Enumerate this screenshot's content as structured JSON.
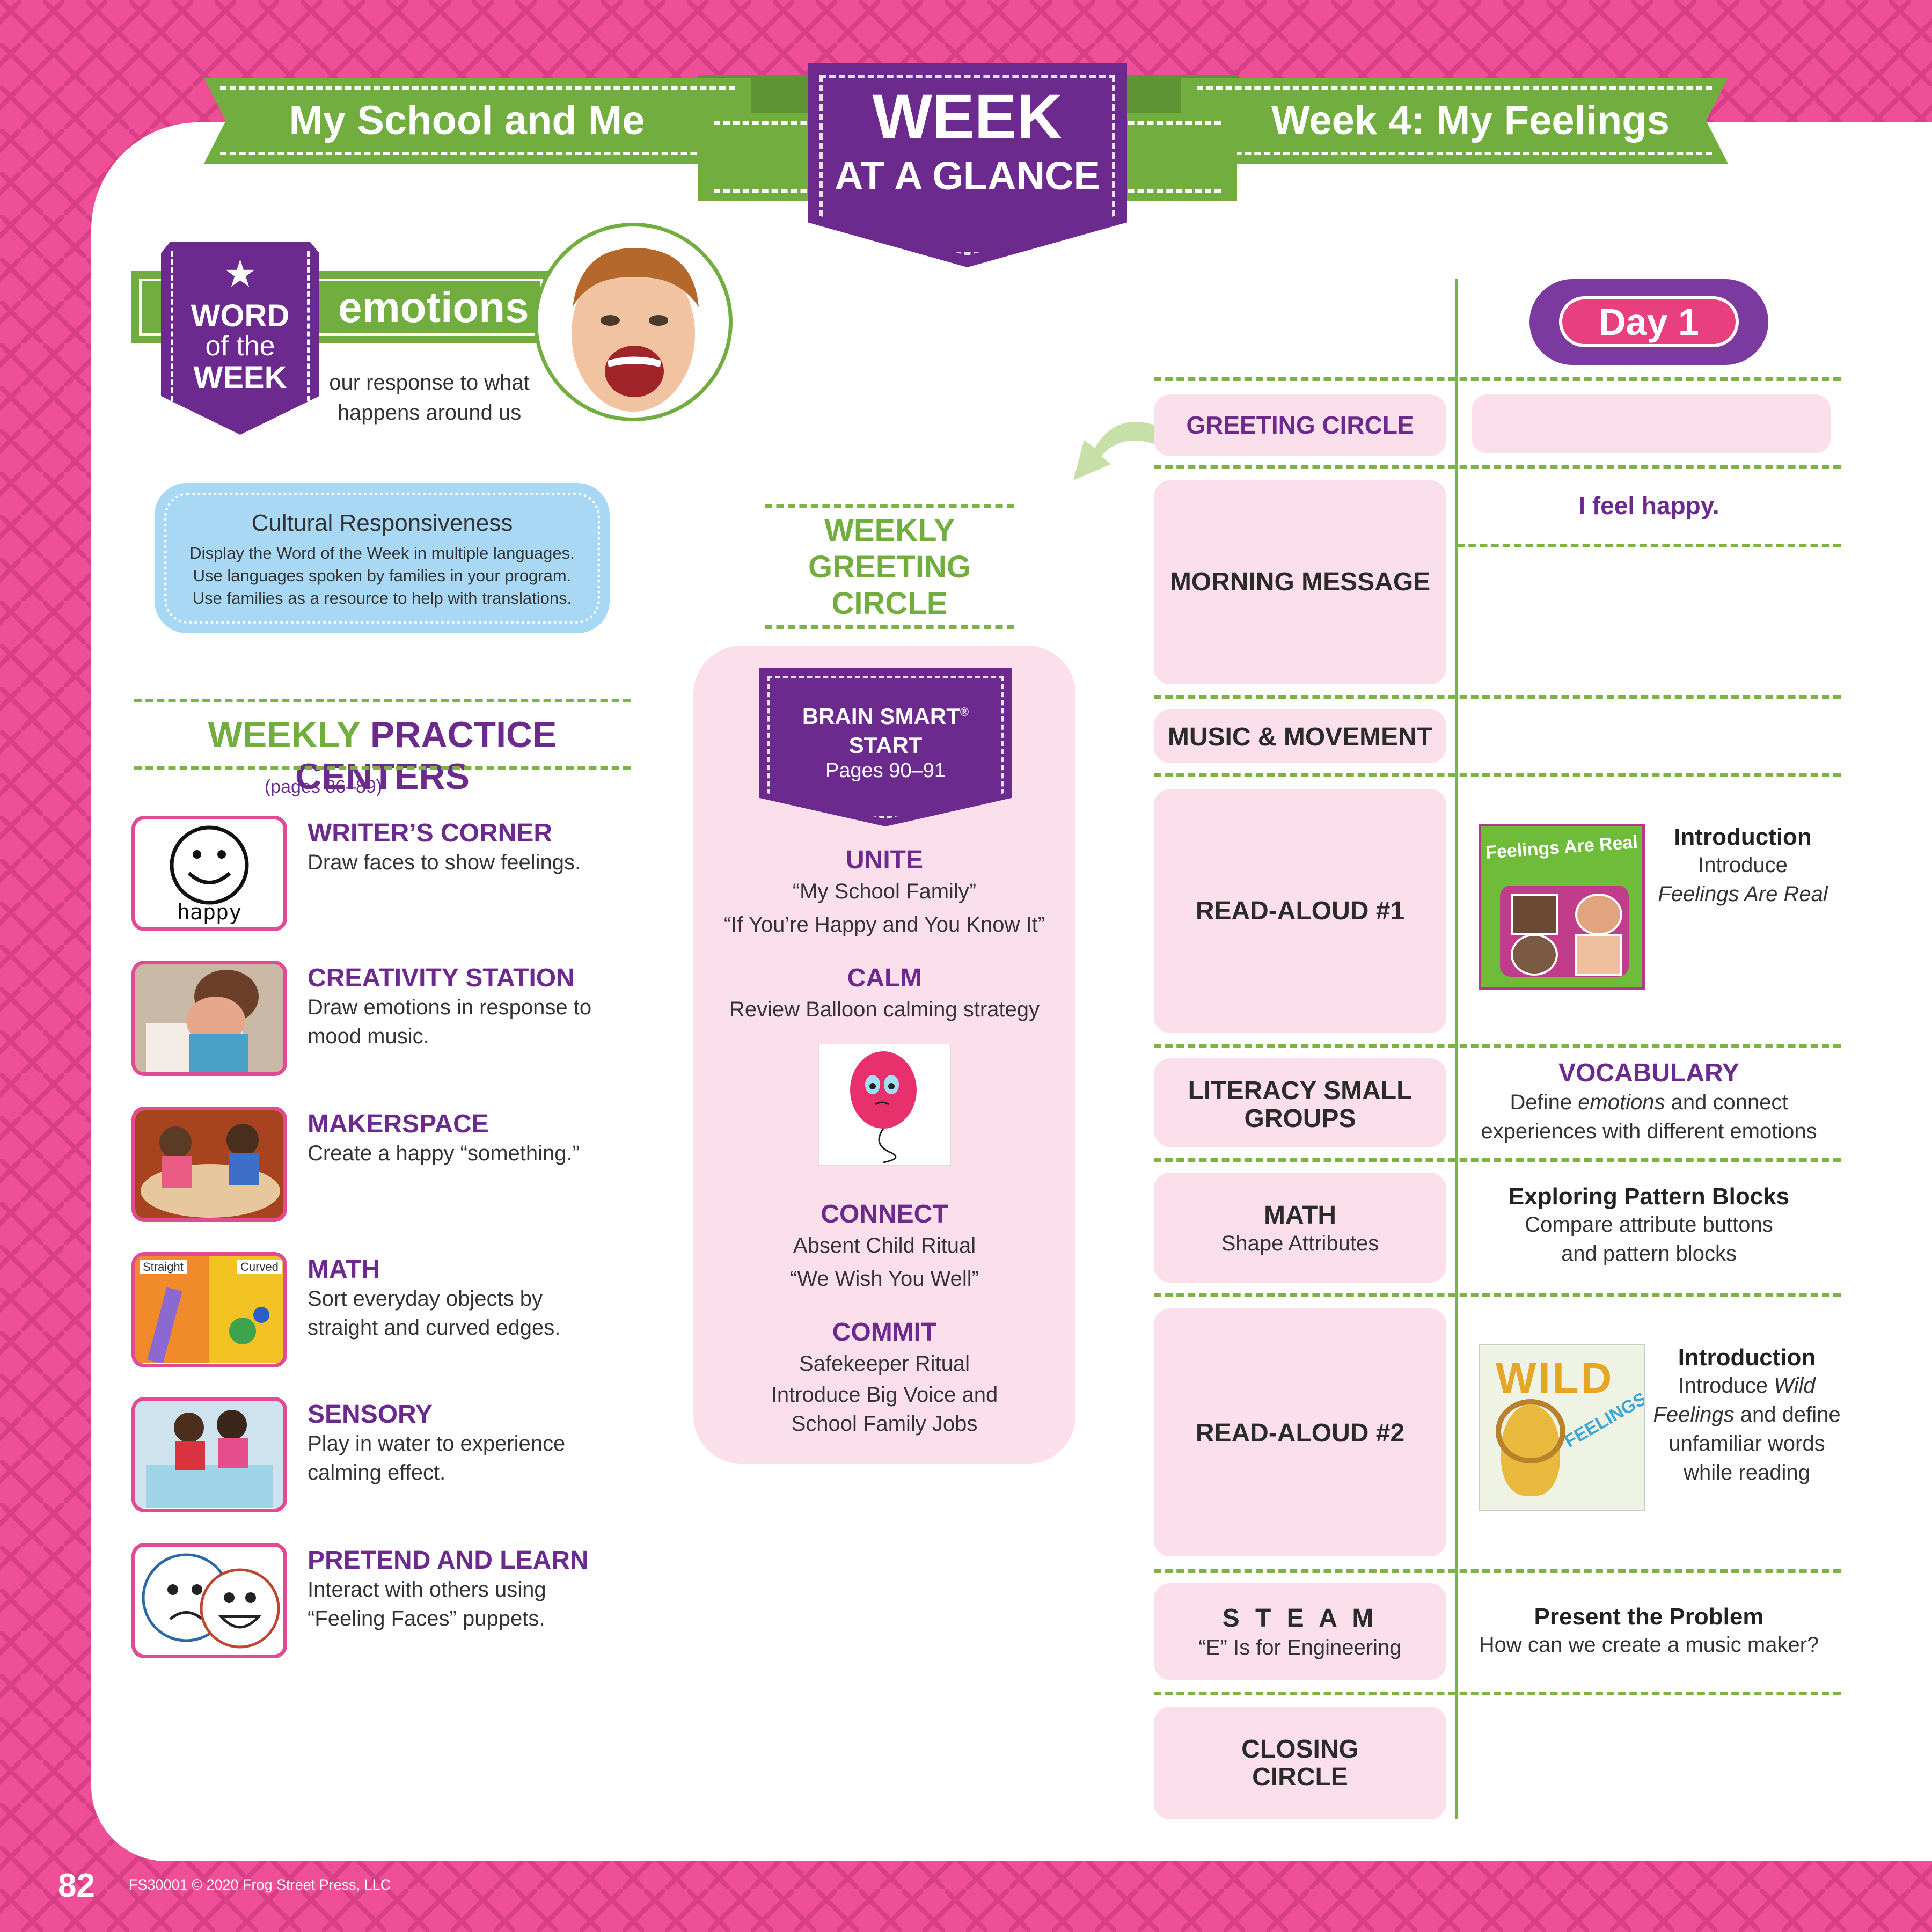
{
  "banner": {
    "left_title": "My School and Me",
    "right_title": "Week 4: My Feelings",
    "badge_line1": "WEEK",
    "badge_line2": "AT A GLANCE"
  },
  "word_of_week": {
    "badge_word": "WORD",
    "badge_of": "of the",
    "badge_week": "WEEK",
    "word": "emotions",
    "definition_line1": "our response to what",
    "definition_line2": "happens around us"
  },
  "cultural": {
    "title": "Cultural Responsiveness",
    "line1": "Display the Word of the Week in multiple languages.",
    "line2": "Use languages spoken by families in your program.",
    "line3": "Use families as a resource to help with translations."
  },
  "centers": {
    "heading_weekly": "WEEKLY",
    "heading_rest": "PRACTICE CENTERS",
    "pages": "(pages 86–89)",
    "happy_label": "happy",
    "thumb_straight": "Straight",
    "thumb_curved": "Curved",
    "items": [
      {
        "title": "WRITER’S CORNER",
        "line1": "Draw faces to show feelings.",
        "line2": ""
      },
      {
        "title": "CREATIVITY STATION",
        "line1": "Draw emotions in response to",
        "line2": "mood music."
      },
      {
        "title": "MAKERSPACE",
        "line1": "Create a happy “something.”",
        "line2": ""
      },
      {
        "title": "MATH",
        "line1": "Sort everyday objects by",
        "line2": "straight and curved edges."
      },
      {
        "title": "SENSORY",
        "line1": "Play in water to experience",
        "line2": "calming effect."
      },
      {
        "title": "PRETEND AND LEARN",
        "line1": "Interact with others using",
        "line2": "“Feeling Faces” puppets."
      }
    ]
  },
  "greeting": {
    "heading_line1": "WEEKLY",
    "heading_line2": "GREETING",
    "heading_line3": "CIRCLE",
    "brain_line1": "BRAIN SMART",
    "brain_reg": "®",
    "brain_line2": "START",
    "brain_pages": "Pages 90–91",
    "unite": "UNITE",
    "unite_1": "“My School Family”",
    "unite_2": "“If You’re Happy and You Know It”",
    "calm": "CALM",
    "calm_1": "Review Balloon calming strategy",
    "connect": "CONNECT",
    "connect_1": "Absent Child Ritual",
    "connect_2": "“We Wish You Well”",
    "commit": "COMMIT",
    "commit_1": "Safekeeper Ritual",
    "commit_2": "Introduce Big Voice and",
    "commit_3": "School Family Jobs"
  },
  "schedule": {
    "day": "Day 1",
    "rows": {
      "greeting_circle": "GREETING CIRCLE",
      "morning_message": "MORNING MESSAGE",
      "music_movement": "MUSIC & MOVEMENT",
      "read_aloud_1": "READ-ALOUD #1",
      "literacy_1": "LITERACY SMALL",
      "literacy_2": "GROUPS",
      "math": "MATH",
      "math_sub": "Shape Attributes",
      "read_aloud_2": "READ-ALOUD #2",
      "steam": "S T E A M",
      "steam_sub": "“E” Is for Engineering",
      "closing_1": "CLOSING",
      "closing_2": "CIRCLE"
    },
    "day1": {
      "morning": "I feel happy.",
      "ra1_title": "Introduction",
      "ra1_line1": "Introduce",
      "ra1_line2": "Feelings Are Real",
      "book1_title": "Feelings Are Real",
      "vocab_title": "VOCABULARY",
      "vocab_line1_a": "Define ",
      "vocab_line1_em": "emotions",
      "vocab_line1_b": " and connect",
      "vocab_line2": "experiences with different emotions",
      "math_title": "Exploring Pattern Blocks",
      "math_line1": "Compare attribute buttons",
      "math_line2": "and pattern blocks",
      "ra2_title": "Introduction",
      "ra2_line1_a": "Introduce ",
      "ra2_line1_em": "Wild",
      "ra2_line2_em": "Feelings",
      "ra2_line2_b": " and define",
      "ra2_line3": "unfamiliar words",
      "ra2_line4": "while reading",
      "book2_title_1": "WILD",
      "book2_title_2": "FEELINGS",
      "steam_title": "Present the Problem",
      "steam_line": "How can we create a music maker?"
    }
  },
  "footer": {
    "page_number": "82",
    "copyright": "FS30001 © 2020 Frog Street Press, LLC"
  },
  "colors": {
    "pink": "#ee4f97",
    "purple": "#6c2a8e",
    "green": "#72ad3f",
    "light_pink": "#fbe0ec",
    "light_blue": "#a9d8f5"
  }
}
